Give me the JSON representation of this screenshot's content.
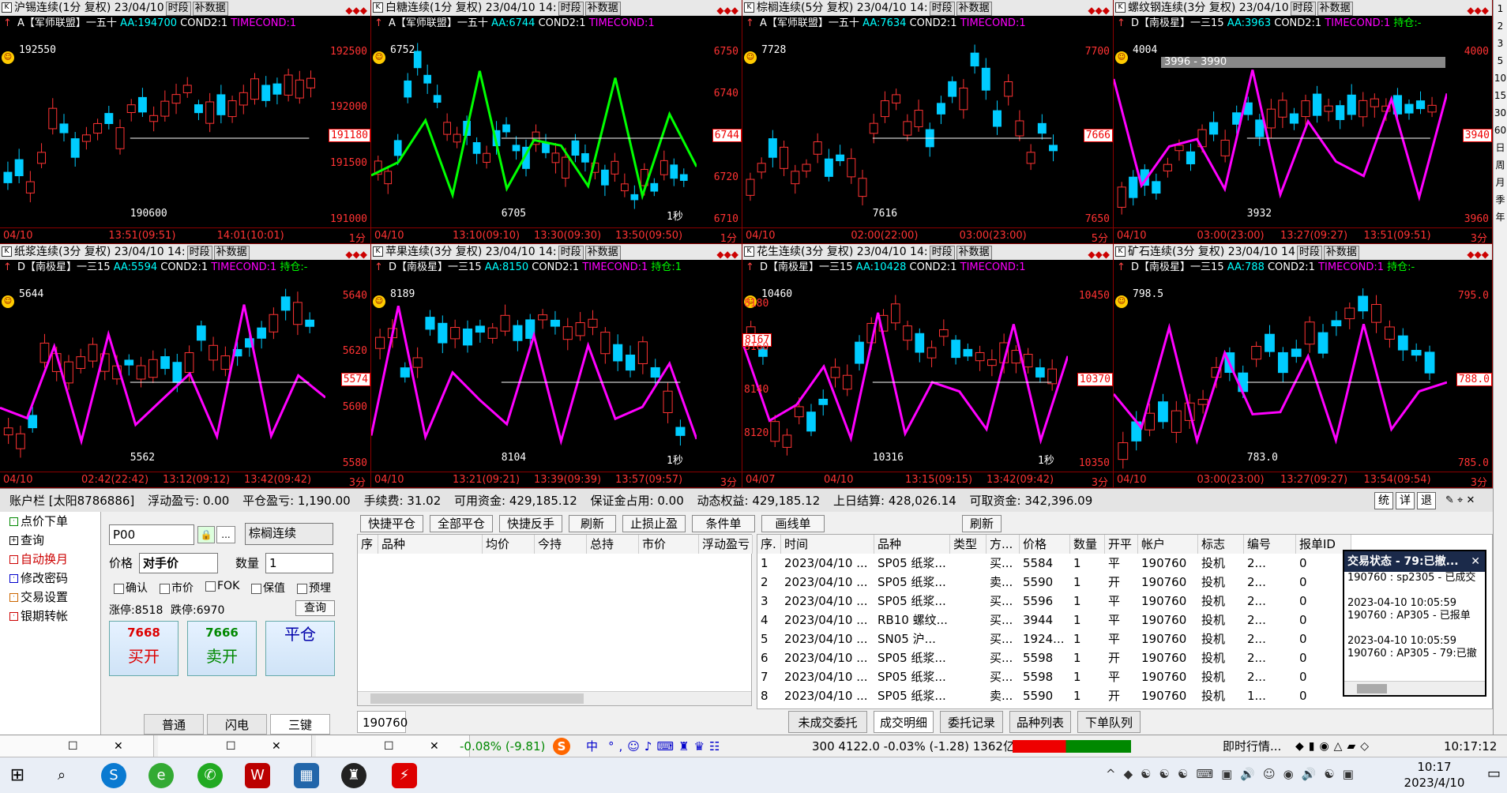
{
  "panels": [
    {
      "title": "沪锡连续(1分 复权) 23/04/10",
      "info_strategy": "A【军师联盟】一五十",
      "aa": "AA:194700",
      "cond": "COND2:1",
      "tcond": "TIMECOND:1",
      "hold": "",
      "yticks": [
        "192500",
        "192000",
        "191500",
        "191000"
      ],
      "last": "191180",
      "hi": "192550",
      "lo": "190600",
      "xticks": [
        "04/10",
        "13:51(09:51)",
        "14:01(10:01)"
      ],
      "period": "1分",
      "extra": ""
    },
    {
      "title": "白糖连续(1分 复权) 23/04/10 14:",
      "info_strategy": "A【军师联盟】一五十",
      "aa": "AA:6744",
      "cond": "COND2:1",
      "tcond": "TIMECOND:1",
      "hold": "",
      "yticks": [
        "6750",
        "6740",
        "6730",
        "6720",
        "6710"
      ],
      "last": "6744",
      "hi": "6752",
      "lo": "6705",
      "xticks": [
        "04/10",
        "13:10(09:10)",
        "13:30(09:30)",
        "13:50(09:50)"
      ],
      "period": "1分",
      "extra": "1秒"
    },
    {
      "title": "棕榈连续(5分 复权) 23/04/10 14:",
      "info_strategy": "A【军师联盟】一五十",
      "aa": "AA:7634",
      "cond": "COND2:1",
      "tcond": "TIMECOND:1",
      "hold": "",
      "yticks": [
        "7700",
        "7650"
      ],
      "last": "7666",
      "hi": "7728",
      "lo": "7616",
      "xticks": [
        "04/10",
        "02:00(22:00)",
        "03:00(23:00)"
      ],
      "period": "5分",
      "extra": ""
    },
    {
      "title": "螺纹钢连续(3分 复权) 23/04/10",
      "info_strategy": "D【南极星】一三15",
      "aa": "AA:3963",
      "cond": "COND2:1",
      "tcond": "TIMECOND:1",
      "hold": "持仓:-",
      "yticks": [
        "4000",
        "3980",
        "3960"
      ],
      "last": "3940",
      "hi": "4004",
      "lo": "3932",
      "xticks": [
        "04/10",
        "03:00(23:00)",
        "13:27(09:27)",
        "13:51(09:51)"
      ],
      "period": "3分",
      "extra": "3996 - 3990"
    },
    {
      "title": "纸浆连续(3分 复权) 23/04/10 14:",
      "info_strategy": "D【南极星】一三15",
      "aa": "AA:5594",
      "cond": "COND2:1",
      "tcond": "TIMECOND:1",
      "hold": "持仓:-",
      "yticks": [
        "5640",
        "5620",
        "5600",
        "5580"
      ],
      "last": "5574",
      "hi": "5644",
      "lo": "5562",
      "xticks": [
        "04/10",
        "02:42(22:42)",
        "13:12(09:12)",
        "13:42(09:42)"
      ],
      "period": "3分",
      "extra": ""
    },
    {
      "title": "苹果连续(3分 复权) 23/04/10 14:",
      "info_strategy": "D【南极星】一三15",
      "aa": "AA:8150",
      "cond": "COND2:1",
      "tcond": "TIMECOND:1",
      "hold": "持仓:1",
      "yticks": [],
      "last": "",
      "hi": "8189",
      "lo": "8104",
      "xticks": [
        "04/10",
        "13:21(09:21)",
        "13:39(09:39)",
        "13:57(09:57)"
      ],
      "period": "3分",
      "extra": "1秒"
    },
    {
      "title": "花生连续(3分 复权) 23/04/10 14:",
      "info_strategy": "D【南极星】一三15",
      "aa": "AA:10428",
      "cond": "COND2:1",
      "tcond": "TIMECOND:1",
      "hold": "",
      "yticks": [
        "8180",
        "8160",
        "8140",
        "8120"
      ],
      "last": "8167",
      "hi": "10460",
      "lo": "10316",
      "xticks": [
        "04/07",
        "04/10",
        "13:15(09:15)",
        "13:42(09:42)"
      ],
      "period": "3分",
      "extra": "1秒"
    },
    {
      "title": "矿石连续(3分 复权) 23/04/10 14",
      "info_strategy": "D【南极星】一三15",
      "aa": "AA:788",
      "cond": "COND2:1",
      "tcond": "TIMECOND:1",
      "hold": "持仓:-",
      "yticks": [
        "795.0",
        "790.0",
        "785.0"
      ],
      "last": "788.0",
      "hi": "798.5",
      "lo": "783.0",
      "xticks": [
        "04/10",
        "03:00(23:00)",
        "13:27(09:27)",
        "13:54(09:54)"
      ],
      "period": "3分",
      "extra": ""
    }
  ],
  "panel_tags": {
    "k": "K",
    "t1": "时段",
    "t2": "补数据"
  },
  "axis7": {
    "a": "10450",
    "b": "10400",
    "c": "10350",
    "last": "10370"
  },
  "account": {
    "name": "账户栏 [太阳8786886]",
    "float_pl": "浮动盈亏: 0.00",
    "close_pl": "平仓盈亏: 1,190.00",
    "fee": "手续费: 31.02",
    "avail": "可用资金: 429,185.12",
    "margin": "保证金占用: 0.00",
    "equity": "动态权益: 429,185.12",
    "prev": "上日结算: 428,026.14",
    "withdraw": "可取资金: 342,396.09",
    "btn1": "统",
    "btn2": "详",
    "btn3": "退"
  },
  "nav": [
    "点价下单",
    "查询",
    "自动换月",
    "修改密码",
    "交易设置",
    "银期转帐"
  ],
  "order": {
    "code": "P00",
    "name": "棕榈连续",
    "price_lbl": "价格",
    "price_val": "对手价",
    "qty_lbl": "数量",
    "qty_val": "1",
    "chk": [
      "确认",
      "市价",
      "FOK",
      "保值",
      "预埋"
    ],
    "limit_up": "涨停:8518",
    "limit_down": "跌停:6970",
    "query": "查询",
    "buy_price": "7668",
    "buy": "买开",
    "sell_price": "7666",
    "sell": "卖开",
    "close": "平仓",
    "tabs": [
      "普通",
      "闪电",
      "三键"
    ]
  },
  "pos": {
    "btns": [
      "快捷平仓",
      "全部平仓",
      "快捷反手",
      "刷新",
      "止损止盈",
      "条件单",
      "画线单"
    ],
    "headers": [
      "序",
      "品种",
      "均价",
      "今持",
      "总持",
      "市价",
      "浮动盈亏"
    ],
    "account": "190760"
  },
  "trades": {
    "refresh": "刷新",
    "headers": [
      "序.",
      "时间",
      "品种",
      "类型",
      "方...",
      "价格",
      "数量",
      "开平",
      "帐户",
      "标志",
      "编号",
      "报单ID"
    ],
    "rows": [
      [
        "1",
        "2023/04/10 ...",
        "SP05 纸浆...",
        "",
        "买...",
        "5584",
        "1",
        "平",
        "190760",
        "投机",
        "2...",
        "0"
      ],
      [
        "2",
        "2023/04/10 ...",
        "SP05 纸浆...",
        "",
        "卖...",
        "5590",
        "1",
        "开",
        "190760",
        "投机",
        "2...",
        "0"
      ],
      [
        "3",
        "2023/04/10 ...",
        "SP05 纸浆...",
        "",
        "买...",
        "5596",
        "1",
        "平",
        "190760",
        "投机",
        "2...",
        "0"
      ],
      [
        "4",
        "2023/04/10 ...",
        "RB10 螺纹...",
        "",
        "买...",
        "3944",
        "1",
        "平",
        "190760",
        "投机",
        "2...",
        "0"
      ],
      [
        "5",
        "2023/04/10 ...",
        "SN05 沪...",
        "",
        "买...",
        "1924...",
        "1",
        "平",
        "190760",
        "投机",
        "2...",
        "0"
      ],
      [
        "6",
        "2023/04/10 ...",
        "SP05 纸浆...",
        "",
        "买...",
        "5598",
        "1",
        "开",
        "190760",
        "投机",
        "2...",
        "0"
      ],
      [
        "7",
        "2023/04/10 ...",
        "SP05 纸浆...",
        "",
        "买...",
        "5598",
        "1",
        "平",
        "190760",
        "投机",
        "2...",
        "0"
      ],
      [
        "8",
        "2023/04/10 ...",
        "SP05 纸浆...",
        "",
        "卖...",
        "5590",
        "1",
        "开",
        "190760",
        "投机",
        "1...",
        "0"
      ]
    ],
    "tabs": [
      "未成交委托",
      "成交明细",
      "委托记录",
      "品种列表",
      "下单队列"
    ]
  },
  "status": {
    "title": "交易状态 - 79:已撤...",
    "lines": [
      "190760 : sp2305 - 已成交",
      "",
      "2023-04-10 10:05:59",
      "190760 : AP305 - 已报单",
      "",
      "2023-04-10 10:05:59",
      "190760 : AP305 - 79:已撤"
    ]
  },
  "strip": {
    "idx1": "-0.08% (-9.81)",
    "idx2": "300 4122.0 -0.03% (-1.28) 1362亿",
    "ime": "中",
    "quote": "即时行情...",
    "time": "10:17:12"
  },
  "taskbar": {
    "time": "10:17",
    "date": "2023/4/10"
  },
  "rbar": [
    "1",
    "2",
    "3",
    "5",
    "10",
    "15",
    "30",
    "60",
    "日",
    "周",
    "月",
    "季",
    "年"
  ]
}
